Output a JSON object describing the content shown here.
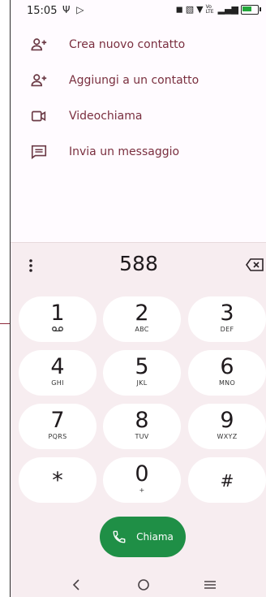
{
  "status_bar": {
    "time": "15:05",
    "network_label": "Vo LTE"
  },
  "actions": [
    {
      "label": "Crea nuovo contatto",
      "icon": "person-add-icon"
    },
    {
      "label": "Aggiungi a un contatto",
      "icon": "person-add-icon"
    },
    {
      "label": "Videochiama",
      "icon": "videocam-icon"
    },
    {
      "label": "Invia un messaggio",
      "icon": "message-icon"
    }
  ],
  "dialer": {
    "number": "588",
    "keys": [
      {
        "digit": "1",
        "letters": ""
      },
      {
        "digit": "2",
        "letters": "ABC"
      },
      {
        "digit": "3",
        "letters": "DEF"
      },
      {
        "digit": "4",
        "letters": "GHI"
      },
      {
        "digit": "5",
        "letters": "JKL"
      },
      {
        "digit": "6",
        "letters": "MNO"
      },
      {
        "digit": "7",
        "letters": "PQRS"
      },
      {
        "digit": "8",
        "letters": "TUV"
      },
      {
        "digit": "9",
        "letters": "WXYZ"
      },
      {
        "digit": "*",
        "letters": ""
      },
      {
        "digit": "0",
        "letters": "+"
      },
      {
        "digit": "#",
        "letters": ""
      }
    ],
    "call_label": "Chiama"
  },
  "colors": {
    "accent_text": "#7a2f3f",
    "call_green": "#1f8f46",
    "dialer_bg": "#f7edf0"
  }
}
